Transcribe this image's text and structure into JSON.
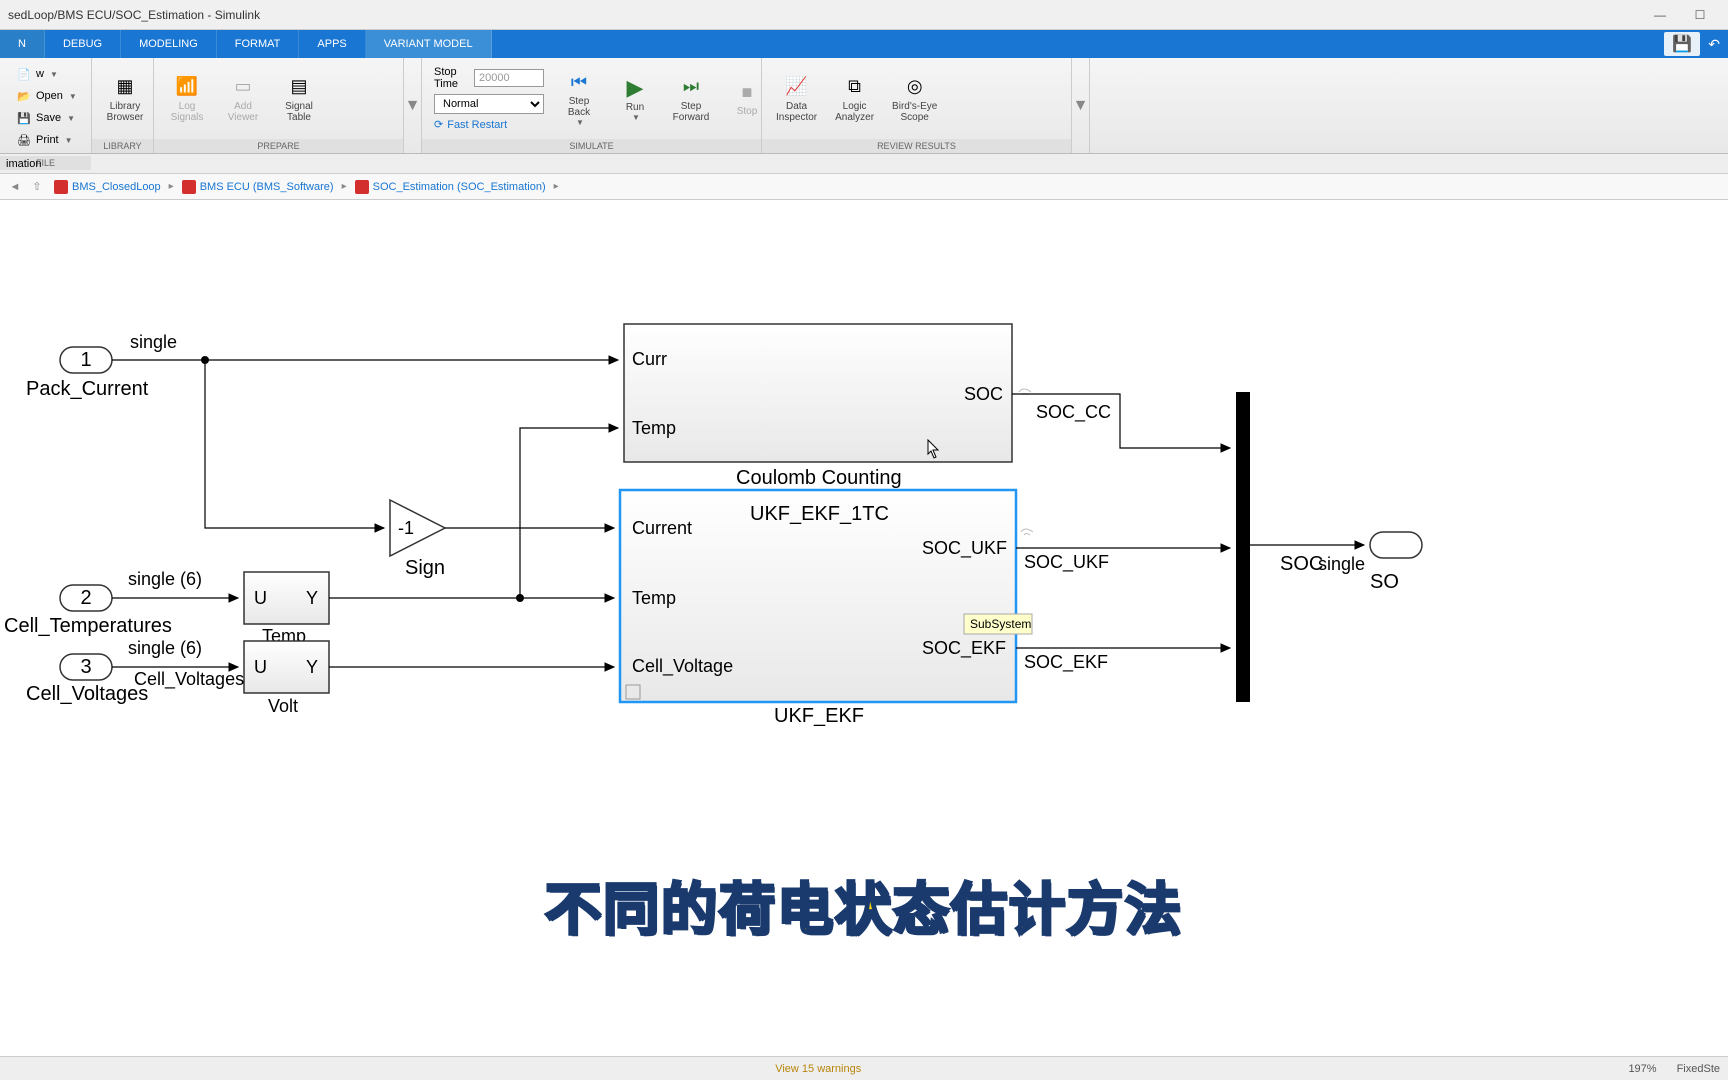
{
  "title": "sedLoop/BMS ECU/SOC_Estimation - Simulink",
  "tabs": [
    "N",
    "DEBUG",
    "MODELING",
    "FORMAT",
    "APPS",
    "VARIANT MODEL"
  ],
  "ribbon": {
    "file": {
      "open": "Open",
      "save": "Save",
      "print": "Print",
      "new_lbl": "w",
      "label": "FILE"
    },
    "library": {
      "browser": "Library\nBrowser",
      "label": "LIBRARY"
    },
    "prepare": {
      "log": "Log\nSignals",
      "add": "Add\nViewer",
      "table": "Signal\nTable",
      "label": "PREPARE"
    },
    "simulate": {
      "stoptime_lbl": "Stop Time",
      "stoptime_val": "20000",
      "mode": "Normal",
      "fast": "Fast Restart",
      "stepback": "Step\nBack",
      "run": "Run",
      "stepfwd": "Step\nForward",
      "stop": "Stop",
      "label": "SIMULATE"
    },
    "review": {
      "data": "Data\nInspector",
      "logic": "Logic\nAnalyzer",
      "scope": "Bird's-Eye\nScope",
      "label": "REVIEW RESULTS"
    }
  },
  "toolbar2": "imation",
  "breadcrumb": [
    "BMS_ClosedLoop",
    "BMS ECU (BMS_Software)",
    "SOC_Estimation (SOC_Estimation)"
  ],
  "diagram": {
    "inputs": [
      {
        "num": "1",
        "name": "Pack_Current",
        "dt": "single"
      },
      {
        "num": "2",
        "name": "Cell_Temperatures",
        "dt": "single (6)"
      },
      {
        "num": "3",
        "name": "Cell_Voltages",
        "dt": "single (6)"
      }
    ],
    "gain": {
      "val": "-1",
      "name": "Sign"
    },
    "selectors": {
      "temp": "Temp",
      "volt": "Volt",
      "u": "U",
      "y": "Y"
    },
    "coulomb": {
      "name": "Coulomb Counting",
      "in": [
        "Curr",
        "Temp"
      ],
      "out": [
        "SOC"
      ],
      "sig_out": "SOC_CC"
    },
    "ukfekf": {
      "title": "UKF_EKF_1TC",
      "name": "UKF_EKF",
      "in": [
        "Current",
        "Temp",
        "Cell_Voltage"
      ],
      "out": [
        "SOC_UKF",
        "SOC_EKF"
      ],
      "sig_out": [
        "SOC_UKF",
        "SOC_EKF"
      ],
      "tooltip": "SubSystem"
    },
    "selector2_label": "Cell_Voltages",
    "out": {
      "soc": "SOC",
      "dt": "single",
      "cut": "SO"
    }
  },
  "caption": "不同的荷电状态估计方法",
  "status": {
    "warn": "View 15 warnings",
    "zoom": "197%",
    "solver": "FixedSte"
  }
}
